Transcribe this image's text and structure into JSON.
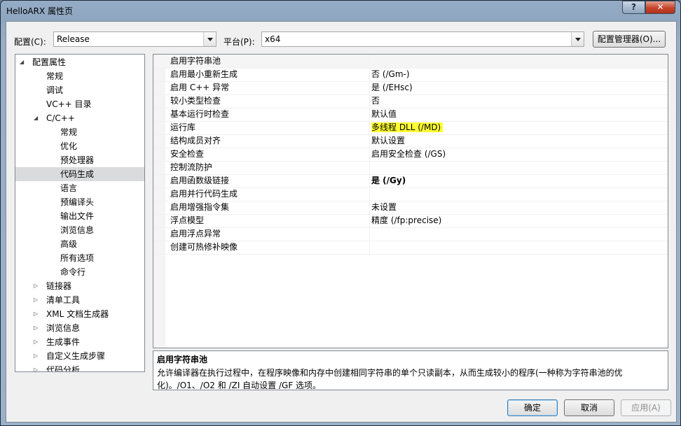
{
  "window": {
    "title": "HelloARX 属性页",
    "help_label": "?",
    "close_label": "✕"
  },
  "toolbar": {
    "config_label": "配置(C):",
    "config_value": "Release",
    "platform_label": "平台(P):",
    "platform_value": "x64",
    "config_manager_label": "配置管理器(O)..."
  },
  "tree": {
    "items": [
      {
        "label": "配置属性",
        "expander": "◢"
      },
      {
        "label": "常规"
      },
      {
        "label": "调试"
      },
      {
        "label": "VC++ 目录"
      },
      {
        "label": "C/C++",
        "expander": "◢"
      },
      {
        "label": "常规"
      },
      {
        "label": "优化"
      },
      {
        "label": "预处理器"
      },
      {
        "label": "代码生成",
        "selected": true
      },
      {
        "label": "语言"
      },
      {
        "label": "预编译头"
      },
      {
        "label": "输出文件"
      },
      {
        "label": "浏览信息"
      },
      {
        "label": "高级"
      },
      {
        "label": "所有选项"
      },
      {
        "label": "命令行"
      },
      {
        "label": "链接器",
        "expander": "▷"
      },
      {
        "label": "清单工具",
        "expander": "▷"
      },
      {
        "label": "XML 文档生成器",
        "expander": "▷"
      },
      {
        "label": "浏览信息",
        "expander": "▷"
      },
      {
        "label": "生成事件",
        "expander": "▷"
      },
      {
        "label": "自定义生成步骤",
        "expander": "▷"
      },
      {
        "label": "代码分析",
        "expander": "▷"
      }
    ]
  },
  "properties": [
    {
      "name": "启用字符串池",
      "value": ""
    },
    {
      "name": "启用最小重新生成",
      "value": "否 (/Gm-)"
    },
    {
      "name": "启用 C++ 异常",
      "value": "是 (/EHsc)"
    },
    {
      "name": "较小类型检查",
      "value": "否"
    },
    {
      "name": "基本运行时检查",
      "value": "默认值"
    },
    {
      "name": "运行库",
      "value": "多线程 DLL (/MD)",
      "highlight": true
    },
    {
      "name": "结构成员对齐",
      "value": "默认设置"
    },
    {
      "name": "安全检查",
      "value": "启用安全检查 (/GS)"
    },
    {
      "name": "控制流防护",
      "value": ""
    },
    {
      "name": "启用函数级链接",
      "value": "是 (/Gy)",
      "bold": true
    },
    {
      "name": "启用并行代码生成",
      "value": ""
    },
    {
      "name": "启用增强指令集",
      "value": "未设置"
    },
    {
      "name": "浮点模型",
      "value": "精度 (/fp:precise)"
    },
    {
      "name": "启用浮点异常",
      "value": ""
    },
    {
      "name": "创建可热修补映像",
      "value": ""
    }
  ],
  "description": {
    "title": "启用字符串池",
    "text": "允许编译器在执行过程中，在程序映像和内存中创建相同字符串的单个只读副本，从而生成较小的程序(一种称为字符串池的优化)。/O1、/O2 和 /ZI 自动设置 /GF 选项。"
  },
  "buttons": {
    "ok": "确定",
    "cancel": "取消",
    "apply": "应用(A)"
  },
  "colors": {
    "highlight": "#ffff33",
    "selection": "#dadbdc",
    "titlebar": "#8ea6c0"
  }
}
